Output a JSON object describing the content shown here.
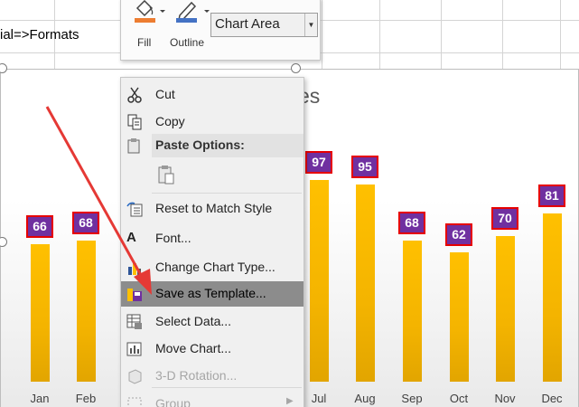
{
  "sheet": {
    "cell_text": "ial=>Formats"
  },
  "mini_toolbar": {
    "fill_label": "Fill",
    "outline_label": "Outline",
    "element_select_value": "Chart Area",
    "fill_color": "#ed7d31",
    "outline_color": "#4472c4"
  },
  "chart": {
    "title_fragment": "es",
    "bar_color": "#ffc000",
    "label_bg": "#7030a0",
    "label_border": "#e60000"
  },
  "chart_data": {
    "type": "bar",
    "categories": [
      "Jan",
      "Feb",
      "Jul",
      "Aug",
      "Sep",
      "Oct",
      "Nov",
      "Dec"
    ],
    "values": [
      66,
      68,
      97,
      95,
      68,
      62,
      70,
      81
    ],
    "ylim": [
      0,
      100
    ]
  },
  "context_menu": {
    "items": [
      {
        "label": "Cut",
        "icon": "scissors-icon",
        "state": "normal"
      },
      {
        "label": "Copy",
        "icon": "copy-icon",
        "state": "normal"
      },
      {
        "label": "Paste Options:",
        "icon": "paste-icon",
        "state": "header"
      },
      {
        "label": "Reset to Match Style",
        "icon": "reset-style-icon",
        "state": "normal"
      },
      {
        "label": "Font...",
        "icon": "font-icon",
        "state": "normal"
      },
      {
        "label": "Change Chart Type...",
        "icon": "chart-type-icon",
        "state": "normal"
      },
      {
        "label": "Save as Template...",
        "icon": "save-template-icon",
        "state": "highlighted"
      },
      {
        "label": "Select Data...",
        "icon": "select-data-icon",
        "state": "normal"
      },
      {
        "label": "Move Chart...",
        "icon": "move-chart-icon",
        "state": "normal"
      },
      {
        "label": "3-D Rotation...",
        "icon": "rotation-icon",
        "state": "disabled"
      },
      {
        "label": "Group",
        "icon": "group-icon",
        "state": "disabled"
      }
    ]
  },
  "annotation": {
    "arrow_color": "#e53935"
  }
}
